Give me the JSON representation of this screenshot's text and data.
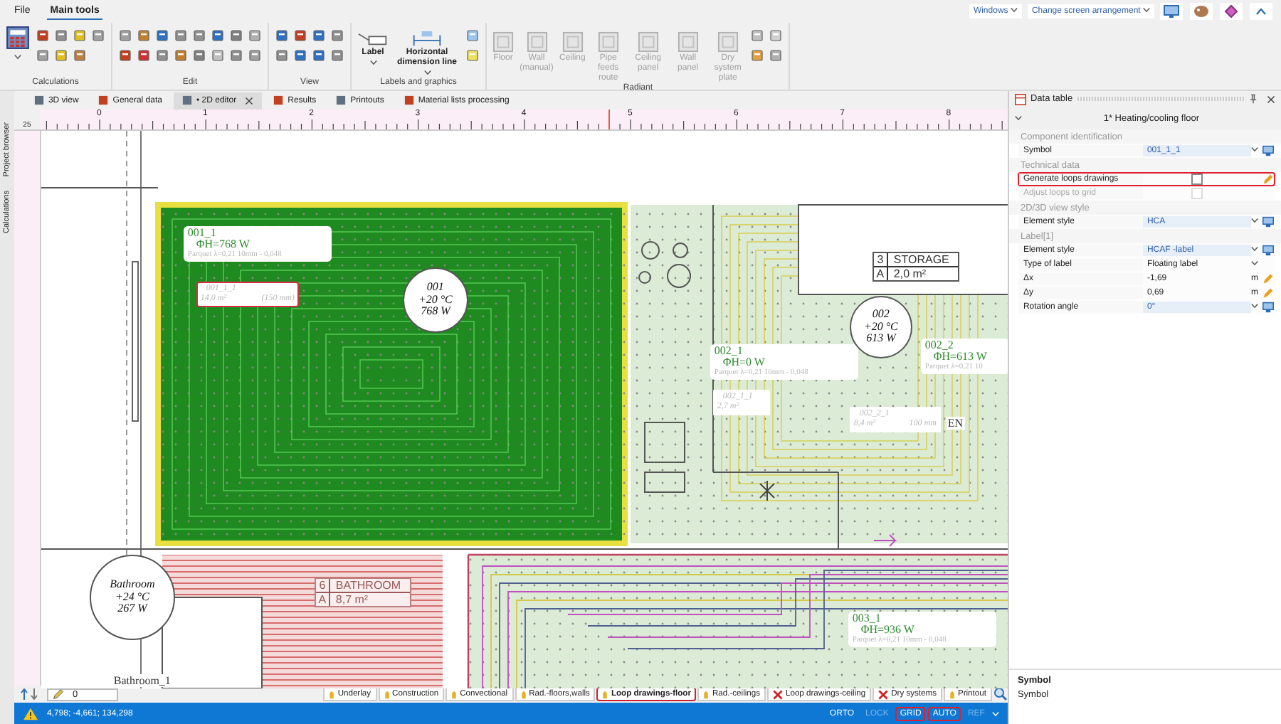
{
  "menu": [
    {
      "label": "File",
      "selected": false
    },
    {
      "label": "Main tools",
      "selected": true
    }
  ],
  "window_controls": {
    "windows": "Windows",
    "arrangement": "Change screen arrangement"
  },
  "ribbon": [
    {
      "name": "Calculations",
      "kind": "calc"
    },
    {
      "name": "Edit",
      "kind": "edit"
    },
    {
      "name": "View",
      "kind": "view"
    },
    {
      "name": "Labels and graphics",
      "kind": "labels",
      "buttons": [
        {
          "label": "Label",
          "disabled": false
        },
        {
          "label": "Horizontal dimension line",
          "disabled": false
        }
      ]
    },
    {
      "name": "Radiant",
      "kind": "radiant",
      "buttons": [
        {
          "label": "Floor",
          "disabled": true
        },
        {
          "label": "Wall (manual)",
          "disabled": true
        },
        {
          "label": "Ceiling",
          "disabled": true
        },
        {
          "label": "Pipe feeds route",
          "disabled": true
        },
        {
          "label": "Ceiling panel",
          "disabled": true
        },
        {
          "label": "Wall panel",
          "disabled": true
        },
        {
          "label": "Dry system plate",
          "disabled": true
        }
      ]
    }
  ],
  "side_strip": [
    "Project browser",
    "Calculations"
  ],
  "doc_tabs": [
    {
      "label": "3D view",
      "selected": false
    },
    {
      "label": "General data",
      "selected": false
    },
    {
      "label": "• 2D editor",
      "selected": true
    },
    {
      "label": "Results",
      "selected": false
    },
    {
      "label": "Printouts",
      "selected": false
    },
    {
      "label": "Material lists processing",
      "selected": false
    }
  ],
  "ruler": {
    "corner": "25",
    "marks": [
      "0",
      "1",
      "2",
      "3",
      "4",
      "5",
      "6",
      "7",
      "8"
    ]
  },
  "canvas": {
    "zone_labels": [
      {
        "title": "001_1",
        "power": "ΦH=768 W",
        "layer": "Parquet λ=0,21 10mm - 0,048"
      },
      {
        "title": "002_1",
        "power": "ΦH=0 W",
        "layer": "Parquet λ=0,21 10mm - 0,048"
      },
      {
        "title": "002_2",
        "power": "ΦH=613 W",
        "layer": "Parquet λ=0,21 10"
      },
      {
        "title": "003_1",
        "power": "ΦH=936 W",
        "layer": "Parquet λ=0,21 10mm - 0,048"
      }
    ],
    "loop_labels": [
      {
        "name": "001_1_1",
        "area": "14,0 m²",
        "spacing": "(150 mm)",
        "highlighted": true
      },
      {
        "name": "002_1_1",
        "area": "2,7 m²",
        "highlighted": false
      },
      {
        "name": "002_2_1",
        "area": "8,4 m²",
        "spacing": "100 mm",
        "highlighted": false
      }
    ],
    "room_circles": [
      {
        "name": "001",
        "temp": "+20 °C",
        "power": "768 W"
      },
      {
        "name": "002",
        "temp": "+20 °C",
        "power": "613 W"
      },
      {
        "name": "Bathroom",
        "temp": "+24 °C",
        "power": "267 W"
      }
    ],
    "room_tags": [
      {
        "number": "3",
        "name": "STORAGE",
        "area_key": "A",
        "area": "2,0 m²",
        "faded": false
      },
      {
        "number": "6",
        "name": "BATHROOM",
        "area_key": "A",
        "area": "8,7 m²",
        "faded": true
      }
    ],
    "fragments": [
      "EN",
      "Bathroom_1"
    ]
  },
  "layer_selector": "0",
  "layer_tabs": [
    {
      "label": "Underlay",
      "visible": true,
      "selected": false
    },
    {
      "label": "Construction",
      "visible": true,
      "selected": false
    },
    {
      "label": "Convectional",
      "visible": true,
      "selected": false
    },
    {
      "label": "Rad.-floors,walls",
      "visible": true,
      "selected": false
    },
    {
      "label": "Loop drawings-floor",
      "visible": true,
      "selected": true
    },
    {
      "label": "Rad.-ceilings",
      "visible": true,
      "selected": false
    },
    {
      "label": "Loop drawings-ceiling",
      "visible": false,
      "selected": false
    },
    {
      "label": "Dry systems",
      "visible": false,
      "selected": false
    },
    {
      "label": "Printout",
      "visible": true,
      "selected": false
    }
  ],
  "status_bar": {
    "coords": "4,798; -4,661; 134,298",
    "toggles": [
      {
        "label": "ORTO",
        "on": true,
        "highlighted": false
      },
      {
        "label": "LOCK",
        "on": false,
        "highlighted": false
      },
      {
        "label": "GRID",
        "on": true,
        "highlighted": true
      },
      {
        "label": "AUTO",
        "on": true,
        "highlighted": true
      },
      {
        "label": "REF",
        "on": false,
        "highlighted": false
      }
    ]
  },
  "data_table": {
    "title": "Data table",
    "component": "1* Heating/cooling floor",
    "groups": [
      {
        "name": "Component identification",
        "rows": [
          {
            "kind": "select",
            "label": "Symbol",
            "value": "001_1_1"
          }
        ]
      },
      {
        "name": "Technical data",
        "rows": [
          {
            "kind": "checkbox",
            "label": "Generate loops drawings",
            "checked": false,
            "disabled": false,
            "highlighted": true
          },
          {
            "kind": "checkbox",
            "label": "Adjust loops to grid",
            "checked": false,
            "disabled": true,
            "highlighted": false
          }
        ]
      },
      {
        "name": "2D/3D view style",
        "rows": [
          {
            "kind": "select",
            "label": "Element style",
            "value": "HCA"
          }
        ]
      },
      {
        "name": "Label[1]",
        "rows": [
          {
            "kind": "select",
            "label": "Element style",
            "value": "HCAF -label"
          },
          {
            "kind": "dropdown",
            "label": "Type of label",
            "value": "Floating label"
          },
          {
            "kind": "number",
            "label": "Δx",
            "value": "-1,69",
            "unit": "m"
          },
          {
            "kind": "number",
            "label": "Δy",
            "value": "0,69",
            "unit": "m"
          },
          {
            "kind": "select",
            "label": "Rotation angle",
            "value": "0°"
          }
        ]
      }
    ]
  },
  "help": {
    "title": "Symbol",
    "text": "Symbol"
  }
}
